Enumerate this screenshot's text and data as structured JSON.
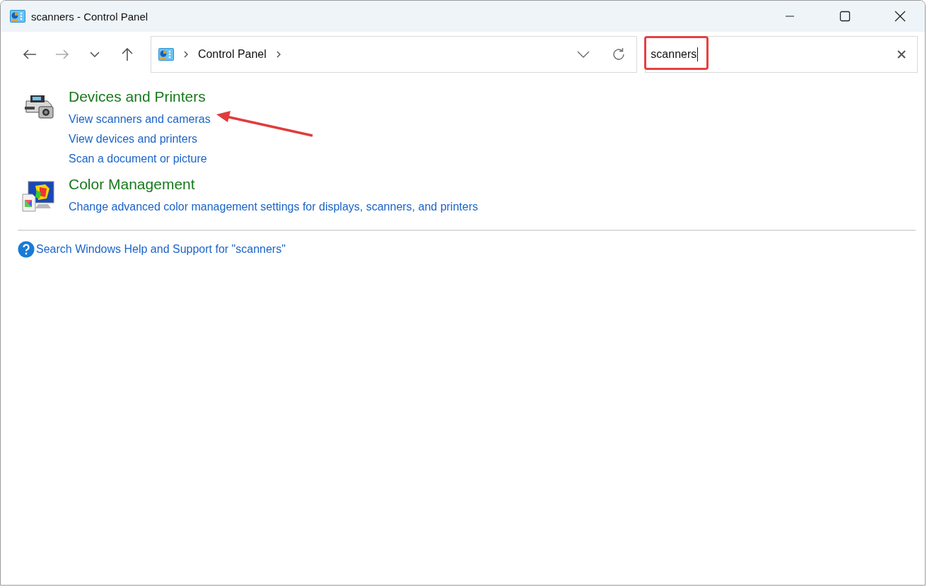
{
  "window": {
    "title": "scanners - Control Panel"
  },
  "address_bar": {
    "breadcrumbs": [
      "Control Panel"
    ]
  },
  "search": {
    "value": "scanners",
    "highlighted": true
  },
  "results": [
    {
      "heading": "Devices and Printers",
      "links": [
        {
          "text": "View scanners and cameras",
          "arrow": true
        },
        {
          "text": "View devices and printers",
          "arrow": false
        },
        {
          "text": "Scan a document or picture",
          "arrow": false
        }
      ]
    },
    {
      "heading": "Color Management",
      "links": [
        {
          "text": "Change advanced color management settings for displays, scanners, and printers",
          "arrow": false
        }
      ]
    }
  ],
  "help_link": "Search Windows Help and Support for \"scanners\""
}
